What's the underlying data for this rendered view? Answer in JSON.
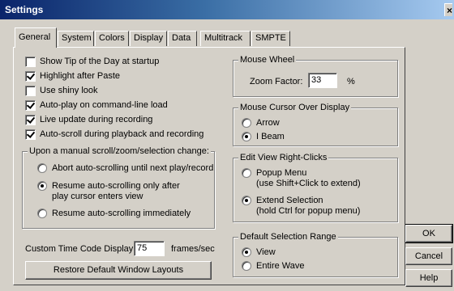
{
  "window": {
    "title": "Settings",
    "close_glyph": "×"
  },
  "tabs": [
    {
      "label": "General",
      "active": true
    },
    {
      "label": "System"
    },
    {
      "label": "Colors"
    },
    {
      "label": "Display"
    },
    {
      "label": "Data"
    },
    {
      "label": "Multitrack"
    },
    {
      "label": "SMPTE"
    }
  ],
  "options": {
    "show_tip": {
      "label": "Show Tip of the Day at startup",
      "checked": false
    },
    "highlight_after_paste": {
      "label": "Highlight after Paste",
      "checked": true
    },
    "use_shiny_look": {
      "label": "Use shiny look",
      "checked": false
    },
    "auto_play": {
      "label": "Auto-play on command-line load",
      "checked": true
    },
    "live_update": {
      "label": "Live update during recording",
      "checked": true
    },
    "auto_scroll": {
      "label": "Auto-scroll during playback and recording",
      "checked": true
    }
  },
  "manual_scroll": {
    "title": "Upon a manual scroll/zoom/selection change:",
    "abort": {
      "label": "Abort auto-scrolling until next play/record",
      "selected": false
    },
    "resume_after_line1": "Resume auto-scrolling only after",
    "resume_after_line2": "play cursor enters view",
    "resume_immediately": {
      "label": "Resume auto-scrolling immediately",
      "selected": false
    }
  },
  "custom_time_code": {
    "label": "Custom Time Code Display",
    "value": "75",
    "unit": "frames/sec"
  },
  "restore_button": "Restore Default Window Layouts",
  "mouse_wheel": {
    "title": "Mouse Wheel",
    "zoom_label": "Zoom Factor:",
    "zoom_value": "33",
    "unit": "%"
  },
  "mouse_cursor": {
    "title": "Mouse Cursor Over Display",
    "arrow": {
      "label": "Arrow",
      "selected": false
    },
    "ibeam": {
      "label": "I Beam",
      "selected": true
    }
  },
  "right_clicks": {
    "title": "Edit View Right-Clicks",
    "popup_line1": "Popup Menu",
    "popup_line2": "(use Shift+Click to extend)",
    "extend_line1": "Extend Selection",
    "extend_line2": "(hold Ctrl for popup menu)"
  },
  "default_range": {
    "title": "Default Selection Range",
    "view": {
      "label": "View",
      "selected": true
    },
    "entire_wave": {
      "label": "Entire Wave",
      "selected": false
    }
  },
  "buttons": {
    "ok": "OK",
    "cancel": "Cancel",
    "help": "Help"
  }
}
